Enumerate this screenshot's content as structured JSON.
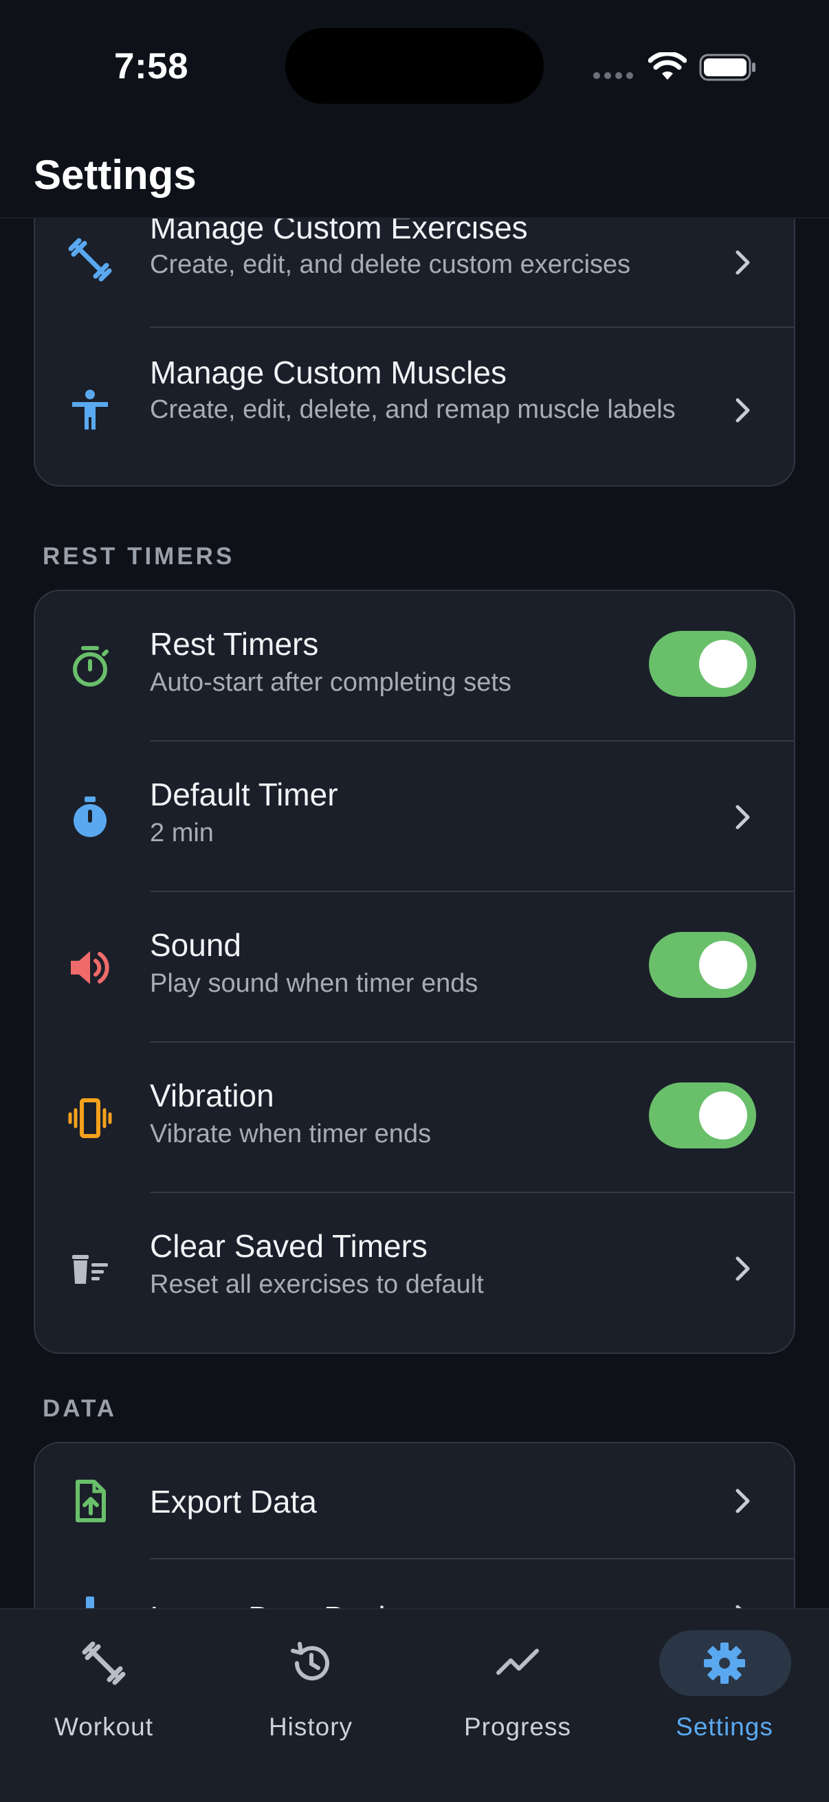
{
  "status_bar": {
    "time": "7:58"
  },
  "header": {
    "title": "Settings"
  },
  "custom_card": {
    "items": [
      {
        "title": "Manage Custom Exercises",
        "subtitle": "Create, edit, and delete custom exercises",
        "icon": "dumbbell-icon"
      },
      {
        "title": "Manage Custom Muscles",
        "subtitle": "Create, edit, delete, and remap muscle labels",
        "icon": "person-icon"
      }
    ]
  },
  "rest_timers": {
    "section_label": "REST TIMERS",
    "items": [
      {
        "title": "Rest Timers",
        "subtitle": "Auto-start after completing sets",
        "icon": "timer-icon",
        "control": "toggle",
        "on": true
      },
      {
        "title": "Default Timer",
        "subtitle": "2 min",
        "icon": "stopwatch-icon",
        "control": "chevron"
      },
      {
        "title": "Sound",
        "subtitle": "Play sound when timer ends",
        "icon": "speaker-icon",
        "control": "toggle",
        "on": true
      },
      {
        "title": "Vibration",
        "subtitle": "Vibrate when timer ends",
        "icon": "vibration-icon",
        "control": "toggle",
        "on": true
      },
      {
        "title": "Clear Saved Timers",
        "subtitle": "Reset all exercises to default",
        "icon": "clear-icon",
        "control": "chevron"
      }
    ]
  },
  "data_section": {
    "section_label": "DATA",
    "items": [
      {
        "title": "Export Data",
        "icon": "file-export-icon"
      },
      {
        "title": "Import Data Backup",
        "icon": "import-icon"
      }
    ]
  },
  "tab_bar": {
    "tabs": [
      {
        "label": "Workout",
        "icon": "dumbbell-icon"
      },
      {
        "label": "History",
        "icon": "history-icon"
      },
      {
        "label": "Progress",
        "icon": "trend-icon"
      },
      {
        "label": "Settings",
        "icon": "gear-icon",
        "active": true
      }
    ]
  },
  "colors": {
    "background": "#0e1118",
    "card": "#1b1f29",
    "accent_blue": "#5aa9f0",
    "toggle_green": "#6abf6b",
    "speaker_red": "#ef6b6b",
    "vibration_orange": "#f4a11d"
  }
}
